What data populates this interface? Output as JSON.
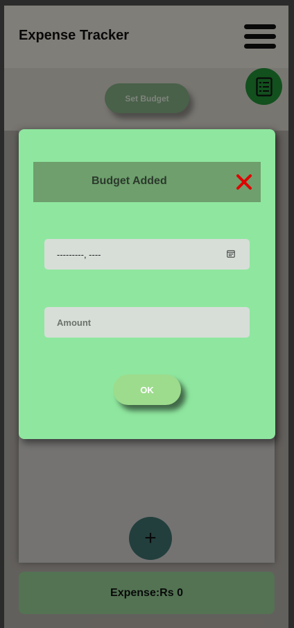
{
  "header": {
    "title": "Expense Tracker",
    "menu_icon": "hamburger-menu-icon"
  },
  "budget": {
    "set_budget_label": "Set Budget",
    "list_icon": "checklist-icon"
  },
  "modal": {
    "title": "Budget Added",
    "close_icon": "close-x-icon",
    "date_value": "---------, ----",
    "date_icon": "calendar-icon",
    "amount_placeholder": "Amount",
    "ok_label": "OK"
  },
  "footer": {
    "add_label": "+",
    "expense_label": "Expense:Rs 0"
  },
  "colors": {
    "modal_bg": "#8fe79f",
    "modal_header": "#6e9f6d",
    "close_red": "#e00000",
    "fab_green": "#1f8a35",
    "add_fab": "#3c6d6a"
  }
}
